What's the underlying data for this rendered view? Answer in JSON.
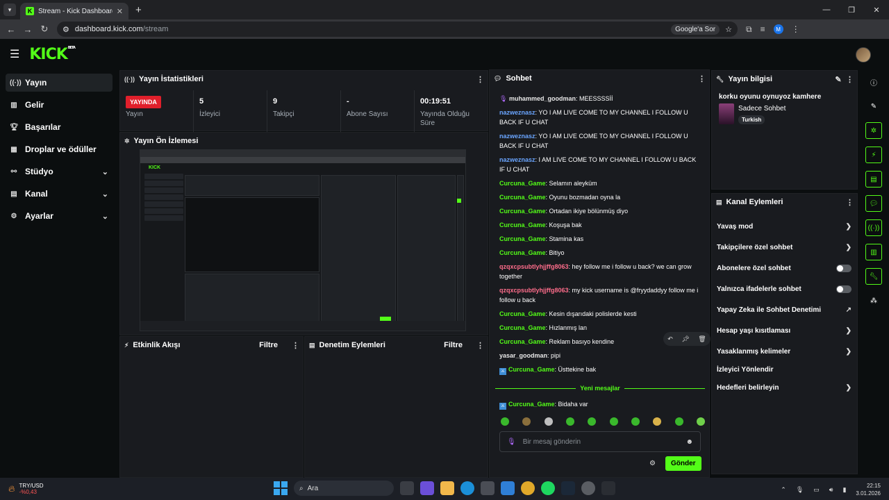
{
  "browser": {
    "tab_title": "Stream - Kick Dashboard",
    "url_host": "dashboard.kick.com",
    "url_path": "/stream",
    "google_btn": "Google'a Sor",
    "profile_letter": "M"
  },
  "app": {
    "logo": "KICK",
    "beta": "BETA"
  },
  "sidebar": {
    "items": [
      {
        "label": "Yayın",
        "icon": "broadcast-icon"
      },
      {
        "label": "Gelir",
        "icon": "revenue-icon"
      },
      {
        "label": "Başarılar",
        "icon": "trophy-icon"
      },
      {
        "label": "Droplar ve ödüller",
        "icon": "drops-icon"
      },
      {
        "label": "Stüdyo",
        "icon": "studio-icon"
      },
      {
        "label": "Kanal",
        "icon": "channel-icon"
      },
      {
        "label": "Ayarlar",
        "icon": "gear-icon"
      }
    ]
  },
  "stats": {
    "title": "Yayın İstatistikleri",
    "live_badge": "YAYINDA",
    "items": [
      {
        "value": "",
        "label": "Yayın"
      },
      {
        "value": "5",
        "label": "İzleyici"
      },
      {
        "value": "9",
        "label": "Takipçi"
      },
      {
        "value": "-",
        "label": "Abone Sayısı"
      },
      {
        "value": "00:19:51",
        "label": "Yayında Olduğu Süre"
      }
    ]
  },
  "preview": {
    "title": "Yayın Ön İzlemesi"
  },
  "activity": {
    "title": "Etkinlik Akışı",
    "filter": "Filtre"
  },
  "moderation": {
    "title": "Denetim Eylemleri",
    "filter": "Filtre"
  },
  "chat": {
    "title": "Sohbet",
    "messages": [
      {
        "user": "muhammed_goodman",
        "color": "w",
        "text": "MEESSSSİİ",
        "badge": "mic"
      },
      {
        "user": "nazweznasz",
        "color": "b",
        "text": "YO I AM LIVE COME TO MY CHANNEL I FOLLOW U BACK IF U CHAT"
      },
      {
        "user": "nazweznasz",
        "color": "b",
        "text": "YO I AM LIVE COME TO MY CHANNEL I FOLLOW U BACK IF U CHAT"
      },
      {
        "user": "nazweznasz",
        "color": "b",
        "text": "I AM LIVE COME TO MY CHANNEL I FOLLOW U BACK IF U CHAT"
      },
      {
        "user": "Curcuna_Game",
        "color": "g",
        "text": "Selamın aleyküm"
      },
      {
        "user": "Curcuna_Game",
        "color": "g",
        "text": "Oyunu bozmadan oyna la"
      },
      {
        "user": "Curcuna_Game",
        "color": "g",
        "text": "Ortadan ikiye bölünmüş diyo"
      },
      {
        "user": "Curcuna_Game",
        "color": "g",
        "text": "Koşuşa bak"
      },
      {
        "user": "Curcuna_Game",
        "color": "g",
        "text": "Stamina kas"
      },
      {
        "user": "Curcuna_Game",
        "color": "g",
        "text": "Bitiyo"
      },
      {
        "user": "qzqxcpsubtlyhjjffg8063",
        "color": "p",
        "text": "hey follow me i follow u back? we can grow together"
      },
      {
        "user": "qzqxcpsubtlyhjjffg8063",
        "color": "p",
        "text": "my kick username is @fryydaddyy follow me i follow u back"
      },
      {
        "user": "Curcuna_Game",
        "color": "g",
        "text": "Kesin dışarıdaki polislerde kesti"
      },
      {
        "user": "Curcuna_Game",
        "color": "g",
        "text": "Hızlanmış lan"
      },
      {
        "user": "Curcuna_Game",
        "color": "g",
        "text": "Reklam basıyo kendine"
      },
      {
        "user": "yasar_goodman",
        "color": "w",
        "text": "pipi"
      },
      {
        "user": "Curcuna_Game",
        "color": "g",
        "text": "Üsttekine bak",
        "badge": "sword"
      }
    ],
    "new_messages": "Yeni mesajlar",
    "after": {
      "user": "Curcuna_Game",
      "text": "Bidaha var"
    },
    "placeholder": "Bir mesaj gönderin",
    "send": "Gönder"
  },
  "stream_info": {
    "title": "Yayın bilgisi",
    "stream_title": "korku oyunu oynuyoz kamhere",
    "category": "Sadece Sohbet",
    "tag": "Turkish"
  },
  "channel_actions": {
    "title": "Kanal Eylemleri",
    "items": [
      {
        "label": "Yavaş mod",
        "kind": "chevron"
      },
      {
        "label": "Takipçilere özel sohbet",
        "kind": "chevron"
      },
      {
        "label": "Abonelere özel sohbet",
        "kind": "toggle"
      },
      {
        "label": "Yalnızca ifadelerle sohbet",
        "kind": "toggle"
      },
      {
        "label": "Yapay Zeka ile Sohbet Denetimi",
        "kind": "external"
      },
      {
        "label": "Hesap yaşı kısıtlaması",
        "kind": "chevron"
      },
      {
        "label": "Yasaklanmış kelimeler",
        "kind": "chevron"
      },
      {
        "label": "İzleyici Yönlendir",
        "kind": "none"
      },
      {
        "label": "Hedefleri belirleyin",
        "kind": "chevron"
      }
    ]
  },
  "taskbar": {
    "ticker": "TRY/USD",
    "change": "-%0,43",
    "search": "Ara",
    "time": "22:15",
    "date": "3.01.2026"
  }
}
